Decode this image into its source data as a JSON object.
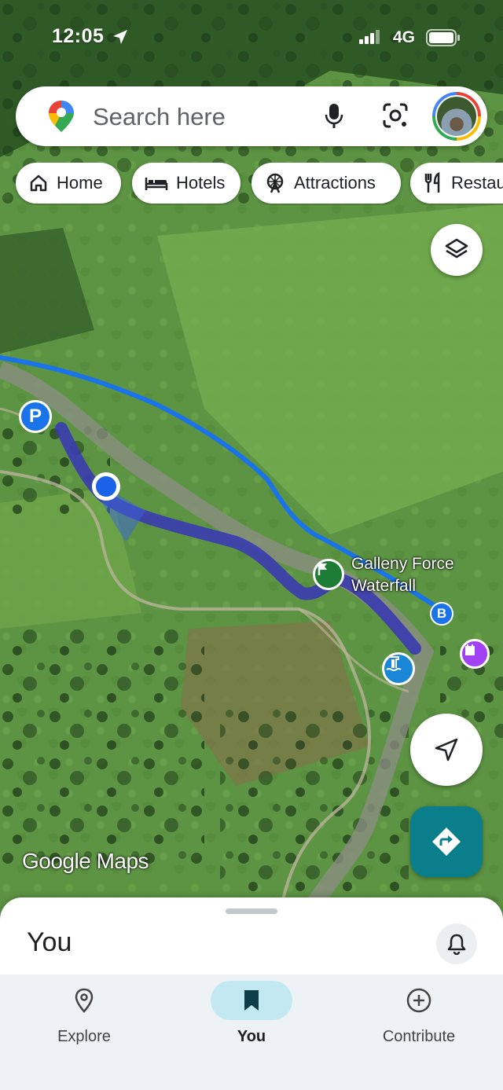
{
  "status_bar": {
    "time": "12:05",
    "network": "4G"
  },
  "search": {
    "placeholder": "Search here"
  },
  "chips": [
    {
      "label": "Home",
      "icon": "home-icon"
    },
    {
      "label": "Hotels",
      "icon": "bed-icon"
    },
    {
      "label": "Attractions",
      "icon": "ferris-wheel-icon"
    },
    {
      "label": "Restau",
      "icon": "restaurant-icon"
    }
  ],
  "map": {
    "watermark": "Google Maps",
    "poi": {
      "line1": "Galleny Force",
      "line2": "Waterfall"
    },
    "markers": {
      "parking": "P",
      "bus": "B"
    }
  },
  "sheet": {
    "title": "You"
  },
  "bottom_nav": [
    {
      "label": "Explore",
      "icon": "location-pin-icon",
      "active": false
    },
    {
      "label": "You",
      "icon": "bookmark-icon",
      "active": true
    },
    {
      "label": "Contribute",
      "icon": "add-circle-icon",
      "active": false
    }
  ],
  "colors": {
    "route_blue": "#1a73e8",
    "walking_path": "#3b3bb0",
    "directions_teal": "#0b7e8c",
    "active_pill": "#c2e9f2"
  }
}
